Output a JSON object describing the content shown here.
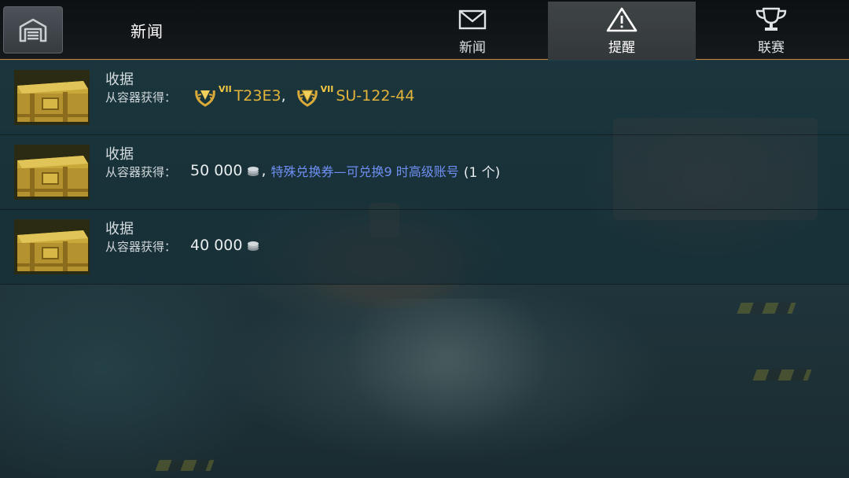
{
  "header": {
    "title": "新闻",
    "tabs": [
      {
        "label": "新闻",
        "icon": "envelope-icon",
        "active": false
      },
      {
        "label": "提醒",
        "icon": "warning-icon",
        "active": true
      },
      {
        "label": "联赛",
        "icon": "trophy-icon",
        "active": false
      }
    ]
  },
  "notifications": [
    {
      "title": "收据",
      "subtitle": "从容器获得：",
      "rewards": [
        {
          "type": "tank",
          "tier": "VII",
          "name": "T23E3",
          "separator": ","
        },
        {
          "type": "tank",
          "tier": "VII",
          "name": "SU-122-44"
        }
      ]
    },
    {
      "title": "收据",
      "subtitle": "从容器获得：",
      "credits": "50 000",
      "separator": ",",
      "link": "特殊兑换券—可兑换9 时高级账号",
      "quantity": "(1 个)"
    },
    {
      "title": "收据",
      "subtitle": "从容器获得：",
      "credits": "40 000"
    }
  ],
  "colors": {
    "accent": "#c8833a",
    "tank_name": "#e3b43a",
    "link": "#6f8ff2"
  }
}
